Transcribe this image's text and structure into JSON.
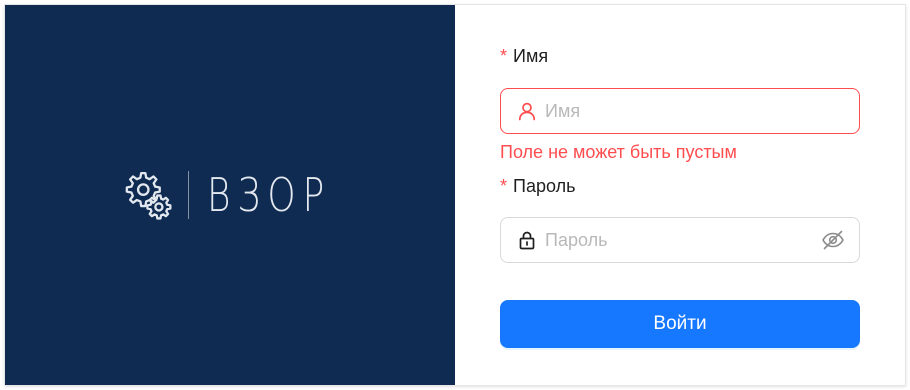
{
  "colors": {
    "brand_background": "#0f2b52",
    "logo_foreground": "#e3e8ef",
    "error": "#ff4d4f",
    "primary": "#1677ff"
  },
  "brand": {
    "logo_icon": "gears-icon",
    "name": "ВЗОР"
  },
  "form": {
    "username": {
      "required_mark": "*",
      "label": "Имя",
      "placeholder": "Имя",
      "value": "",
      "prefix_icon": "user-icon",
      "status": "error",
      "error_message": "Поле не может быть пустым"
    },
    "password": {
      "required_mark": "*",
      "label": "Пароль",
      "placeholder": "Пароль",
      "value": "",
      "prefix_icon": "lock-icon",
      "suffix_icon": "eye-invisible-icon"
    },
    "submit_label": "Войти"
  }
}
